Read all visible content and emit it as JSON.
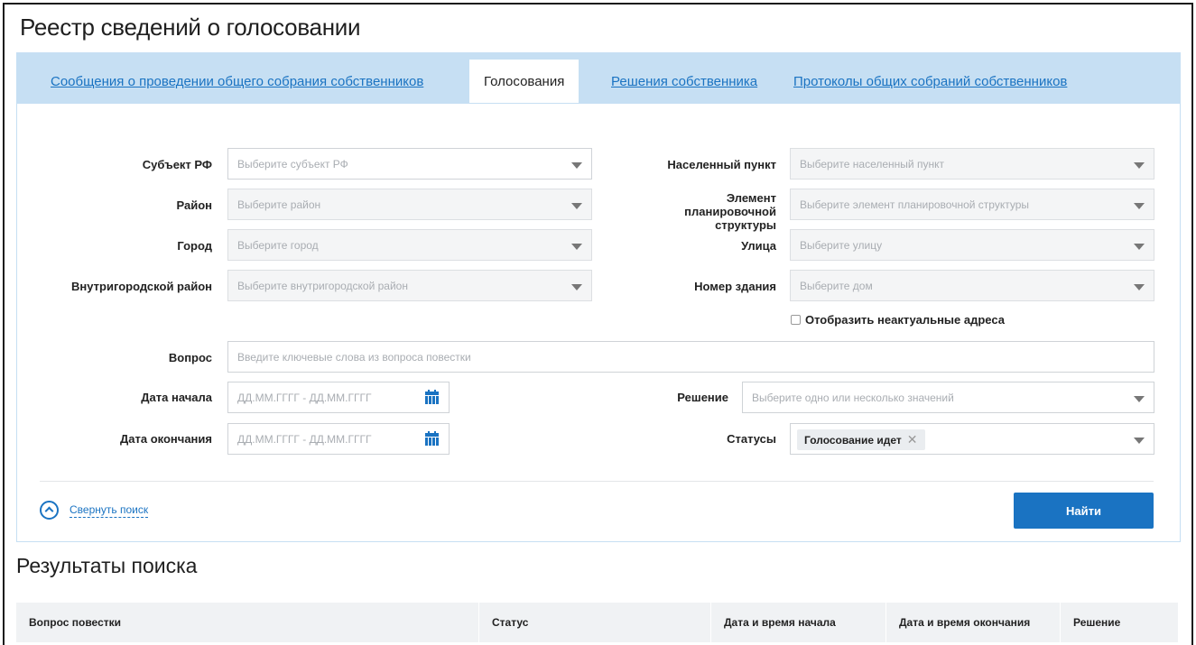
{
  "page": {
    "title": "Реестр сведений о голосовании"
  },
  "tabs": [
    {
      "label": "Сообщения о проведении общего собрания собственников",
      "active": false
    },
    {
      "label": "Голосования",
      "active": true
    },
    {
      "label": "Решения собственника",
      "active": false
    },
    {
      "label": "Протоколы общих собраний собственников",
      "active": false
    }
  ],
  "filters": {
    "subject": {
      "label": "Субъект РФ",
      "placeholder": "Выберите субъект РФ"
    },
    "district": {
      "label": "Район",
      "placeholder": "Выберите район"
    },
    "city": {
      "label": "Город",
      "placeholder": "Выберите город"
    },
    "intracity": {
      "label": "Внутригородской район",
      "placeholder": "Выберите внутригородской район"
    },
    "locality": {
      "label": "Населенный пункт",
      "placeholder": "Выберите населенный пункт"
    },
    "planning": {
      "label": "Элемент планировочной структуры",
      "placeholder": "Выберите элемент планировочной структуры"
    },
    "street": {
      "label": "Улица",
      "placeholder": "Выберите улицу"
    },
    "building": {
      "label": "Номер здания",
      "placeholder": "Выберите дом"
    },
    "show_inactive": {
      "label": "Отобразить неактуальные адреса",
      "checked": false
    },
    "question": {
      "label": "Вопрос",
      "placeholder": "Введите ключевые слова из вопроса повестки"
    },
    "start_date": {
      "label": "Дата начала",
      "placeholder": "ДД.ММ.ГГГГ  -  ДД.ММ.ГГГГ"
    },
    "end_date": {
      "label": "Дата окончания",
      "placeholder": "ДД.ММ.ГГГГ  -  ДД.ММ.ГГГГ"
    },
    "decision": {
      "label": "Решение",
      "placeholder": "Выберите одно или несколько значений"
    },
    "statuses": {
      "label": "Статусы",
      "selected": [
        "Голосование идет"
      ]
    }
  },
  "actions": {
    "collapse_label": "Свернуть поиск",
    "find_label": "Найти"
  },
  "results": {
    "title": "Результаты поиска",
    "columns": [
      "Вопрос повестки",
      "Статус",
      "Дата и время начала",
      "Дата и время окончания",
      "Решение"
    ]
  },
  "colors": {
    "accent": "#1a73c2",
    "tab_bar": "#c6dff3",
    "table_header": "#f0f2f4"
  },
  "icons": {
    "calendar": "calendar-icon",
    "dropdown": "chevron-down-icon",
    "collapse": "chevron-up-circle-icon",
    "remove_tag": "close-icon"
  }
}
